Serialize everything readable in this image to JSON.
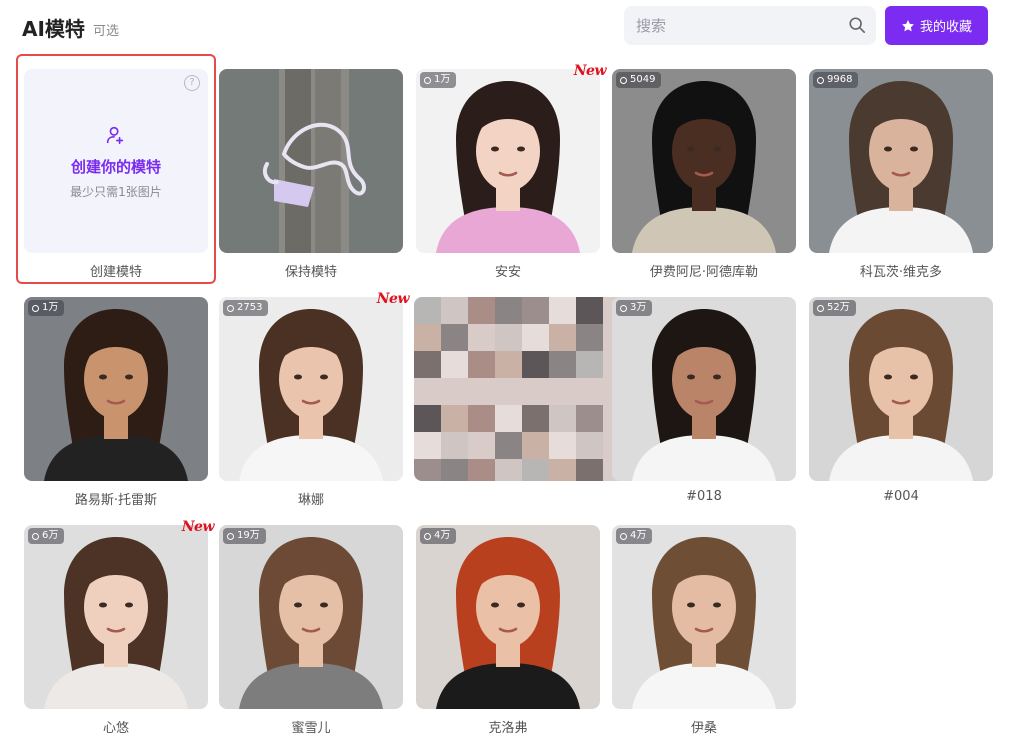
{
  "header": {
    "title": "AI模特",
    "subtitle": "可选",
    "search_placeholder": "搜索",
    "favorites_label": "我的收藏"
  },
  "create_card": {
    "title": "创建你的模特",
    "subtitle": "最少只需1张图片",
    "name": "创建模特",
    "help": "?"
  },
  "models": [
    {
      "name": "保持模特",
      "count": "",
      "new": false,
      "palette": "keep"
    },
    {
      "name": "安安",
      "count": "1万",
      "new": true,
      "palette": "asian-pink"
    },
    {
      "name": "伊费阿尼·阿德库勒",
      "count": "5049",
      "new": false,
      "palette": "dark"
    },
    {
      "name": "科瓦茨·维克多",
      "count": "9968",
      "new": false,
      "palette": "light-male"
    },
    {
      "name": "路易斯·托雷斯",
      "count": "1万",
      "new": false,
      "palette": "male-tank"
    },
    {
      "name": "琳娜",
      "count": "2753",
      "new": true,
      "palette": "female-white"
    },
    {
      "name": "",
      "count": "",
      "new": false,
      "palette": "pixelated"
    },
    {
      "name": "#018",
      "count": "3万",
      "new": false,
      "palette": "hijab"
    },
    {
      "name": "#004",
      "count": "52万",
      "new": false,
      "palette": "female-brown"
    },
    {
      "name": "心悠",
      "count": "6万",
      "new": true,
      "palette": "asian-lace"
    },
    {
      "name": "蜜雪儿",
      "count": "19万",
      "new": false,
      "palette": "female-curly"
    },
    {
      "name": "克洛弗",
      "count": "4万",
      "new": false,
      "palette": "redhead"
    },
    {
      "name": "伊桑",
      "count": "4万",
      "new": false,
      "palette": "young-male"
    }
  ],
  "new_label": "New"
}
